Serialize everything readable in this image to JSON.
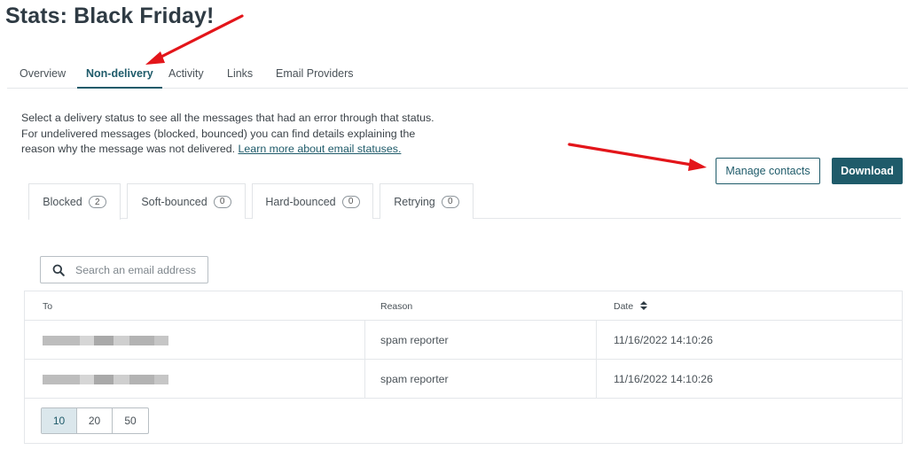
{
  "page": {
    "title": "Stats: Black Friday!"
  },
  "top_tabs": [
    {
      "label": "Overview",
      "active": false
    },
    {
      "label": "Non-delivery",
      "active": true
    },
    {
      "label": "Activity",
      "active": false
    },
    {
      "label": "Links",
      "active": false
    },
    {
      "label": "Email Providers",
      "active": false
    }
  ],
  "description": {
    "text": "Select a delivery status to see all the messages that had an error through that status. For undelivered messages (blocked, bounced) you can find details explaining the reason why the message was not delivered. ",
    "link": "Learn more about email statuses."
  },
  "actions": {
    "manage_contacts": "Manage contacts",
    "download": "Download"
  },
  "status_tabs": [
    {
      "label": "Blocked",
      "count": "2",
      "active": true
    },
    {
      "label": "Soft-bounced",
      "count": "0",
      "active": false
    },
    {
      "label": "Hard-bounced",
      "count": "0",
      "active": false
    },
    {
      "label": "Retrying",
      "count": "0",
      "active": false
    }
  ],
  "search": {
    "placeholder": "Search an email address",
    "value": "",
    "icon": "search-icon"
  },
  "table": {
    "columns": {
      "to": "To",
      "reason": "Reason",
      "date": "Date"
    },
    "sort_icon": "sort-icon",
    "rows": [
      {
        "to": "",
        "reason": "spam reporter",
        "date": "11/16/2022 14:10:26"
      },
      {
        "to": "",
        "reason": "spam reporter",
        "date": "11/16/2022 14:10:26"
      }
    ]
  },
  "pagination": {
    "options": [
      "10",
      "20",
      "50"
    ],
    "selected": "10"
  },
  "colors": {
    "accent": "#1f5b6a",
    "annotation_arrow": "#e3151a"
  }
}
